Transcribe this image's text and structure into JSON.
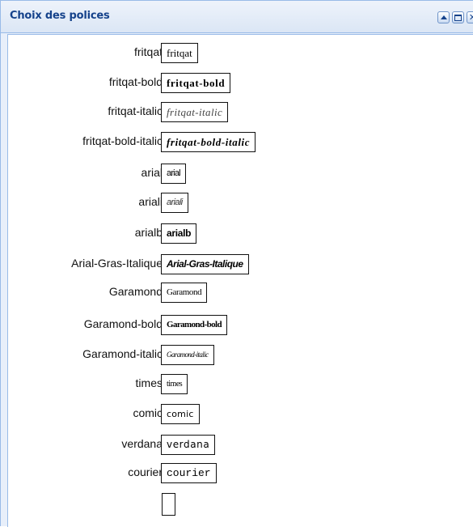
{
  "panel": {
    "title": "Choix des polices",
    "tools": [
      "collapse-icon",
      "maximize-icon",
      "close-icon"
    ]
  },
  "fonts": [
    {
      "label": "fritqat",
      "preview": "fritqat"
    },
    {
      "label": "fritqat-bold",
      "preview": "fritqat-bold"
    },
    {
      "label": "fritqat-italic",
      "preview": "fritqat-italic"
    },
    {
      "label": "fritqat-bold-italic",
      "preview": "fritqat-bold-italic"
    },
    {
      "label": "arial",
      "preview": "arial"
    },
    {
      "label": "ariali",
      "preview": "ariali"
    },
    {
      "label": "arialb",
      "preview": "arialb"
    },
    {
      "label": "Arial-Gras-Italique",
      "preview": "Arial-Gras-Italique"
    },
    {
      "label": "Garamond",
      "preview": "Garamond"
    },
    {
      "label": "Garamond-bold",
      "preview": "Garamond-bold"
    },
    {
      "label": "Garamond-italic",
      "preview": "Garamond-italic"
    },
    {
      "label": "times",
      "preview": "times"
    },
    {
      "label": "comic",
      "preview": "comic"
    },
    {
      "label": "verdana",
      "preview": "verdana"
    },
    {
      "label": "courier",
      "preview": "courier"
    }
  ],
  "colors": {
    "header_text": "#15428b",
    "panel_border": "#99bbe8",
    "panel_background": "#e8effa"
  }
}
